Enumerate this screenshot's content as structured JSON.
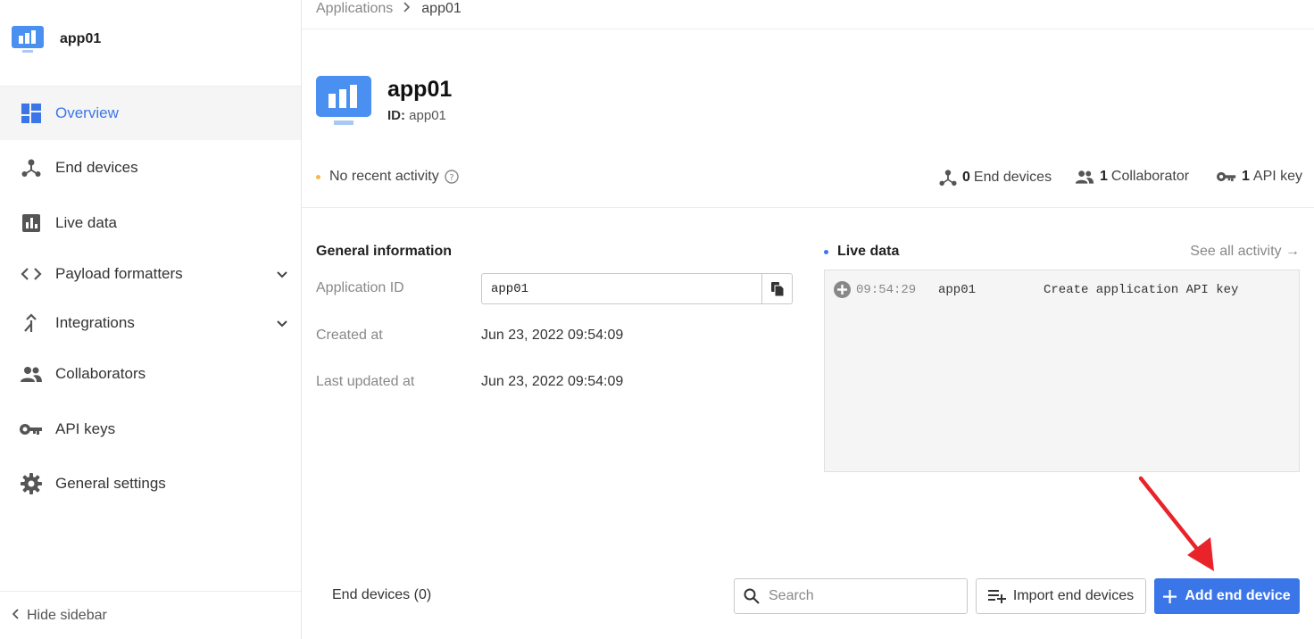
{
  "sidebar": {
    "app_name": "app01",
    "items": [
      {
        "label": "Overview"
      },
      {
        "label": "End devices"
      },
      {
        "label": "Live data"
      },
      {
        "label": "Payload formatters"
      },
      {
        "label": "Integrations"
      },
      {
        "label": "Collaborators"
      },
      {
        "label": "API keys"
      },
      {
        "label": "General settings"
      }
    ],
    "hide_label": "Hide sidebar"
  },
  "breadcrumb": {
    "root": "Applications",
    "current": "app01"
  },
  "header": {
    "title": "app01",
    "id_label": "ID:",
    "id_value": "app01"
  },
  "activity": {
    "status": "No recent activity",
    "end_devices_count": "0",
    "end_devices_label": "End devices",
    "collaborators_count": "1",
    "collaborators_label": "Collaborator",
    "api_keys_count": "1",
    "api_keys_label": "API key"
  },
  "general": {
    "title": "General information",
    "app_id_label": "Application ID",
    "app_id_value": "app01",
    "created_label": "Created at",
    "created_value": "Jun 23, 2022 09:54:09",
    "updated_label": "Last updated at",
    "updated_value": "Jun 23, 2022 09:54:09"
  },
  "live": {
    "title": "Live data",
    "see_all": "See all activity →",
    "events": [
      {
        "time": "09:54:29",
        "entity": "app01",
        "message": "Create application API key"
      }
    ]
  },
  "devices_bar": {
    "label": "End devices (0)",
    "search_placeholder": "Search",
    "import_label": "Import end devices",
    "add_label": "Add end device"
  },
  "colors": {
    "accent": "#3b76e8",
    "status_dot": "#f5b84a",
    "arrow": "#e8232a"
  }
}
